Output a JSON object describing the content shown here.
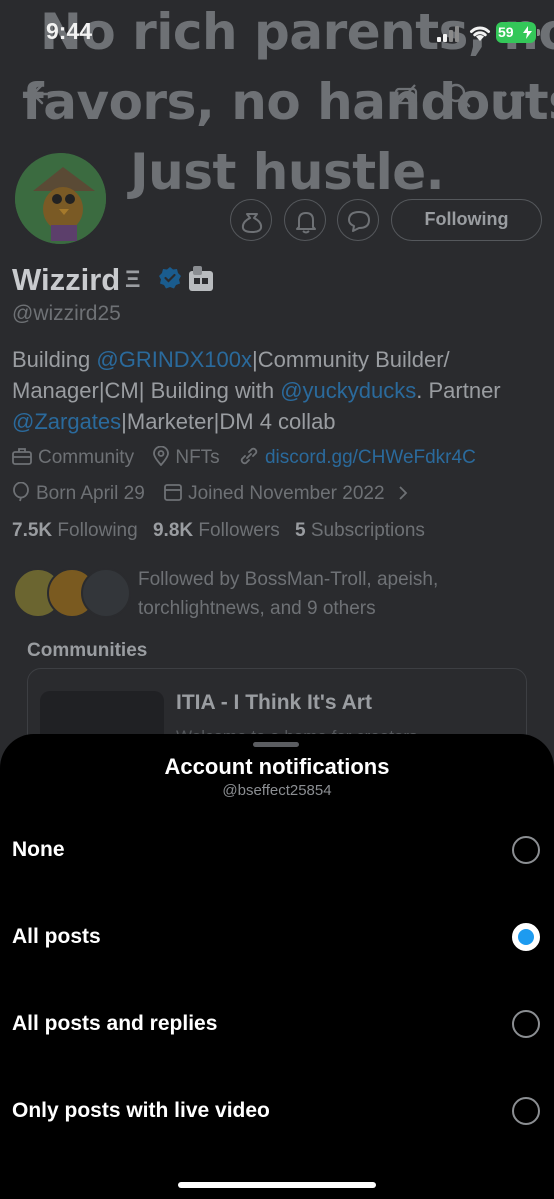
{
  "status_bar": {
    "time": "9:44",
    "battery": "59"
  },
  "banner": {
    "line1": "No rich parents, no",
    "line2": "favors, no handouts.",
    "line3": "Just hustle."
  },
  "header": {
    "back_icon": "back-arrow-icon",
    "icons": [
      "no-camera-icon",
      "search-icon",
      "more-icon"
    ]
  },
  "profile": {
    "name": "Wizzird",
    "name_suffix": "Ξ",
    "handle": "@wizzird25",
    "following_button": "Following",
    "bio": {
      "p1": "Building ",
      "m1": "@GRINDX100x",
      "p2": "|Community Builder/ Manager|CM| Building with ",
      "m2": "@yuckyducks",
      "p3": ". Partner ",
      "m3": "@Zargates",
      "p4": "|Marketer|DM 4 collab"
    },
    "category": "Community",
    "location": "NFTs",
    "link": "discord.gg/CHWeFdkr4C",
    "born": "Born April 29",
    "joined": "Joined November 2022",
    "stats": {
      "following_count": "7.5K",
      "following_label": "Following",
      "followers_count": "9.8K",
      "followers_label": "Followers",
      "subscriptions_count": "5",
      "subscriptions_label": "Subscriptions"
    },
    "followed_by": "Followed by BossMan-Troll, apeish, torchlightnews, and 9 others",
    "communities_title": "Communities",
    "community": {
      "name": "ITIA - I Think It's Art",
      "desc": "Welcome to a home for creators"
    }
  },
  "sheet": {
    "title": "Account notifications",
    "subtitle": "@bseffect25854",
    "options": [
      {
        "label": "None",
        "selected": false
      },
      {
        "label": "All posts",
        "selected": true
      },
      {
        "label": "All posts and replies",
        "selected": false
      },
      {
        "label": "Only posts with live video",
        "selected": false
      }
    ]
  },
  "colors": {
    "accent": "#1d9bf0",
    "sheet_bg": "#000000",
    "dim_bg": "#2a2b2e"
  }
}
